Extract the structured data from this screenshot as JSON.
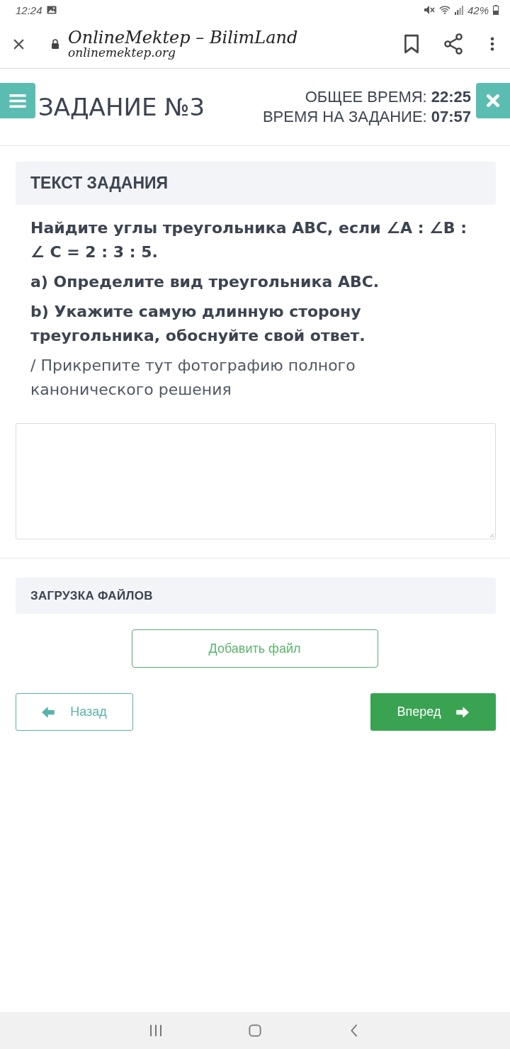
{
  "status_bar": {
    "time": "12:24",
    "battery": "42%"
  },
  "browser_bar": {
    "title": "OnlineMektep – BilimLand",
    "url": "onlinemektep.org"
  },
  "task_header": {
    "title": "ЗАДАНИЕ №3",
    "timers": [
      {
        "label": "ОБЩЕЕ ВРЕМЯ:",
        "value": "22:25"
      },
      {
        "label": "ВРЕМЯ НА ЗАДАНИЕ:",
        "value": "07:57"
      }
    ]
  },
  "task_section": {
    "heading": "ТЕКСТ ЗАДАНИЯ",
    "paragraphs": [
      {
        "kind": "question",
        "text": "Найдите углы треугольника ABC, если ∠A : ∠B : ∠ C = 2 : 3 : 5."
      },
      {
        "kind": "question",
        "text": "a) Определите вид треугольника ABC."
      },
      {
        "kind": "question",
        "text": "b) Укажите самую длинную сторону треугольника, обоснуйте свой ответ."
      },
      {
        "kind": "note",
        "text": "/ Прикрепите тут фотографию полного канонического решения"
      }
    ]
  },
  "upload_section": {
    "heading": "ЗАГРУЗКА ФАЙЛОВ",
    "add_button": "Добавить файл"
  },
  "navigation": {
    "back": "Назад",
    "next": "Вперед"
  }
}
